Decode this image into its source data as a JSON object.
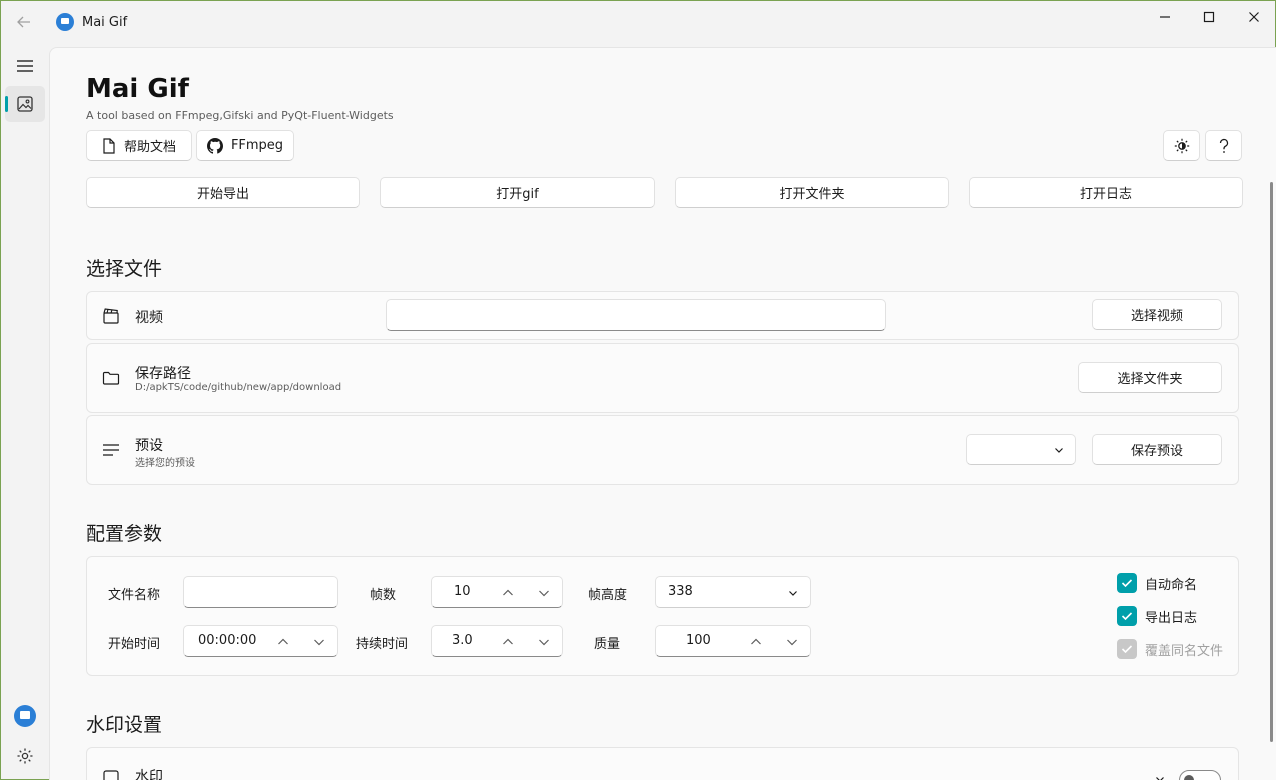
{
  "window": {
    "title": "Mai Gif"
  },
  "header": {
    "title": "Mai Gif",
    "subtitle": "A tool based on FFmpeg,Gifski and PyQt-Fluent-Widgets",
    "help_button": "帮助文档",
    "ffmpeg_button": "FFmpeg"
  },
  "actions": {
    "start_export": "开始导出",
    "open_gif": "打开gif",
    "open_folder": "打开文件夹",
    "open_log": "打开日志"
  },
  "select_file": {
    "section_title": "选择文件",
    "video_label": "视频",
    "video_value": "",
    "choose_video": "选择视频",
    "save_path_label": "保存路径",
    "save_path_value": "D:/apkTS/code/github/new/app/download",
    "choose_folder": "选择文件夹",
    "preset_label": "预设",
    "preset_hint": "选择您的预设",
    "preset_selected": "",
    "save_preset": "保存预设"
  },
  "config": {
    "section_title": "配置参数",
    "file_name_label": "文件名称",
    "file_name_value": "",
    "frames_label": "帧数",
    "frames_value": "10",
    "frame_height_label": "帧高度",
    "frame_height_value": "338",
    "start_time_label": "开始时间",
    "start_time_value": "00:00:00",
    "duration_label": "持续时间",
    "duration_value": "3.0",
    "quality_label": "质量",
    "quality_value": "100",
    "auto_name_label": "自动命名",
    "auto_name_checked": true,
    "export_log_label": "导出日志",
    "export_log_checked": true,
    "overwrite_label": "覆盖同名文件",
    "overwrite_checked": true
  },
  "watermark": {
    "section_title": "水印设置",
    "watermark_label": "水印"
  },
  "colors": {
    "accent": "#009faa",
    "window_border": "#7aa251",
    "app_icon": "#2b7fd6"
  }
}
